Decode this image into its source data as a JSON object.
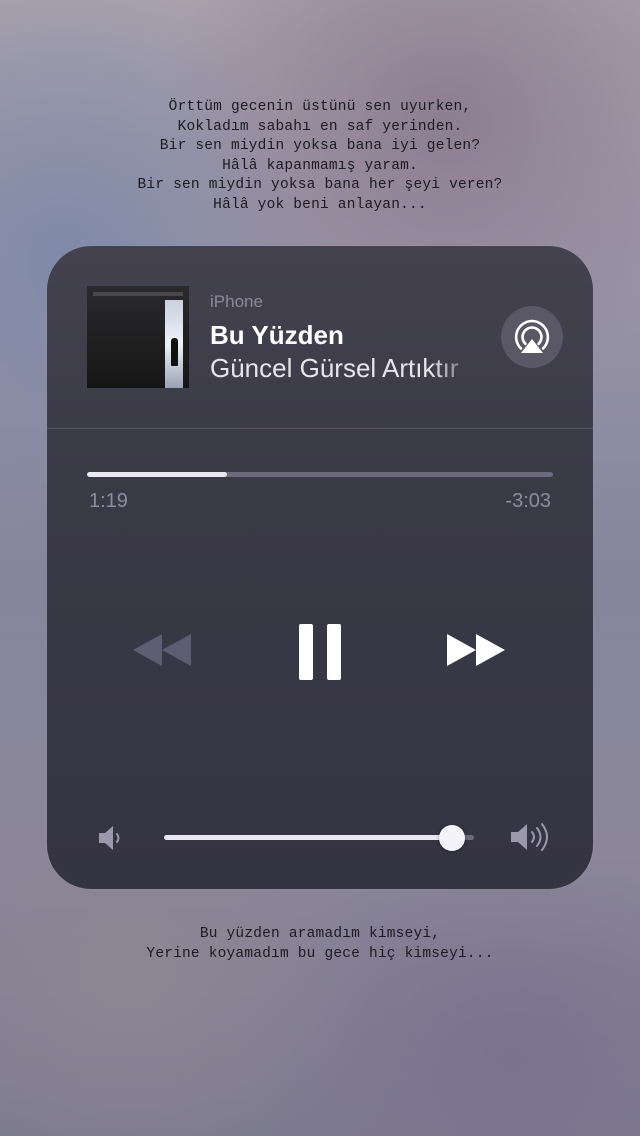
{
  "lyrics": {
    "top": [
      "Örttüm gecenin üstünü sen uyurken,",
      "Kokladım sabahı en saf yerinden.",
      "Bir sen miydin yoksa bana iyi gelen?",
      "Hâlâ kapanmamış yaram.",
      "Bir sen miydin yoksa bana her şeyi veren?",
      "Hâlâ yok beni anlayan..."
    ],
    "bottom": [
      "Bu yüzden aramadım kimseyi,",
      "Yerine koyamadım bu gece hiç kimseyi..."
    ]
  },
  "player": {
    "device": "iPhone",
    "title": "Bu Yüzden",
    "artist": "Güncel Gürsel Artıktır",
    "elapsed": "1:19",
    "remaining": "-3:03",
    "progress_fraction": 0.3,
    "volume_fraction": 0.93,
    "icons": {
      "airplay": "airplay-icon",
      "rewind": "rewind-icon",
      "pause": "pause-icon",
      "forward": "fast-forward-icon",
      "volume_low": "volume-low-icon",
      "volume_high": "volume-high-icon"
    }
  },
  "colors": {
    "card": "#3a3946",
    "text_primary": "#ffffff",
    "text_secondary": "#8e8ca0",
    "track": "#6c6a7c",
    "fill": "#e9e8ee"
  }
}
